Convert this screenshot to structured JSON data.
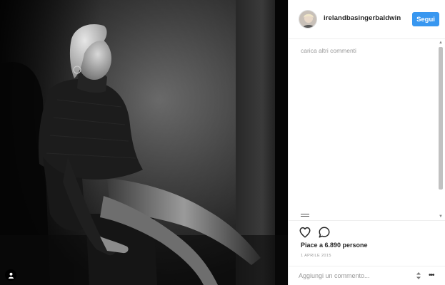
{
  "post": {
    "username": "irelandbasingerbaldwin",
    "follow_label": "Segui",
    "load_more_label": "carica altri commenti",
    "likes_text": "Piace a 6.890 persone",
    "date_text": "1 APRILE 2015",
    "add_comment_placeholder": "Aggiungi un commento...",
    "more_options": "•••"
  },
  "icons": {
    "like": "heart-outline-icon",
    "comment": "speech-bubble-icon",
    "user_tag": "person-icon"
  },
  "colors": {
    "follow_button": "#3897f0",
    "text_primary": "#262626",
    "text_secondary": "#999999"
  }
}
